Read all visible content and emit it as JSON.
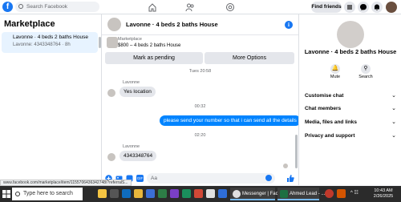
{
  "topbar": {
    "search_placeholder": "Search Facebook",
    "find_friends": "Find friends",
    "logo": "f",
    "icons": [
      "home-icon",
      "friends-icon",
      "groups-icon",
      "menu-grid-icon",
      "messenger-icon",
      "bell-icon"
    ]
  },
  "sidebar": {
    "title": "Marketplace",
    "items": [
      {
        "title": "Lavonne · 4 beds 2 baths House",
        "subtitle": "Lavonne: 4343348764 · 8h"
      }
    ]
  },
  "chat": {
    "title": "Lavonne · 4 beds 2 baths House",
    "marketplace_label": "Marketplace",
    "listing": "$800 – 4 beds 2 baths House",
    "mark_pending": "Mark as pending",
    "more_options": "More Options",
    "messages": [
      {
        "kind": "stamp",
        "text": "Tues 20:58"
      },
      {
        "kind": "sender",
        "text": "Lavonne"
      },
      {
        "kind": "in",
        "text": "Yes location"
      },
      {
        "kind": "stamp",
        "text": "00:32"
      },
      {
        "kind": "out",
        "text": "please send your number so that i can send all the details"
      },
      {
        "kind": "stamp",
        "text": "02:20"
      },
      {
        "kind": "sender",
        "text": "Lavonne"
      },
      {
        "kind": "in",
        "text": "4343348764"
      }
    ],
    "composer_placeholder": "Aa"
  },
  "details": {
    "title": "Lavonne · 4 beds 2 baths House",
    "actions": [
      {
        "label": "Mute",
        "icon": "bell-icon"
      },
      {
        "label": "Search",
        "icon": "search-icon"
      }
    ],
    "sections": [
      "Customise chat",
      "Chat members",
      "Media, files and links",
      "Privacy and support"
    ]
  },
  "status_url": "www.facebook.com/marketplace/item/1155706436342748/?referralS...",
  "taskbar": {
    "search_placeholder": "Type here to search",
    "apps": [
      "Messenger | Face...",
      "Ahmed Lead - ..."
    ],
    "time": "10:43 AM",
    "date": "2/26/2025"
  },
  "colors": {
    "brand": "#1877f2",
    "outgoing_bubble": "#0084ff",
    "incoming_bubble": "#e4e6eb",
    "selected_item": "#e7f3ff"
  }
}
